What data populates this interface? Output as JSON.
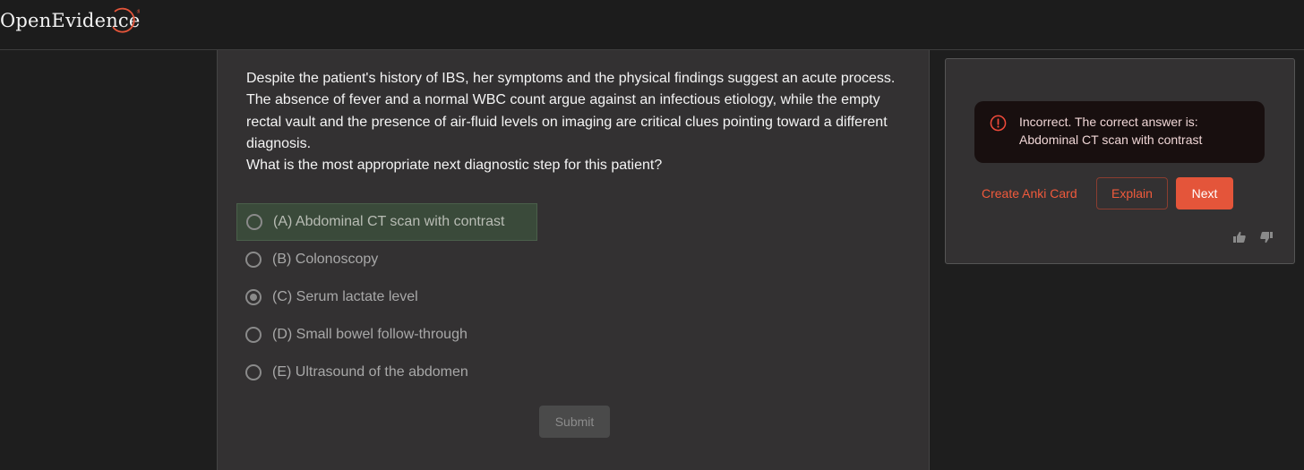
{
  "header": {
    "logo_text": "OpenEvidence",
    "trademark": "®"
  },
  "question": {
    "paragraphs": [
      "Despite the patient's history of IBS, her symptoms and the physical findings suggest an acute process. The absence of fever and a normal WBC count argue against an infectious etiology, while the empty rectal vault and the presence of air-fluid levels on imaging are critical clues pointing toward a different diagnosis.",
      "What is the most appropriate next diagnostic step for this patient?"
    ],
    "options": [
      {
        "label": "(A) Abdominal CT scan with contrast",
        "state": "correct"
      },
      {
        "label": "(B) Colonoscopy",
        "state": "none"
      },
      {
        "label": "(C) Serum lactate level",
        "state": "selected"
      },
      {
        "label": "(D) Small bowel follow-through",
        "state": "none"
      },
      {
        "label": "(E) Ultrasound of the abdomen",
        "state": "none"
      }
    ],
    "submit_label": "Submit"
  },
  "feedback": {
    "alert_text": "Incorrect. The correct answer is: Abdominal CT scan with contrast",
    "anki_label": "Create Anki Card",
    "explain_label": "Explain",
    "next_label": "Next",
    "icons": [
      "error-circle-icon",
      "thumbs-up-icon",
      "thumbs-down-icon"
    ]
  },
  "colors": {
    "accent": "#e4553a",
    "background": "#1e1e1e",
    "panel": "#333132",
    "correct_highlight": "#3a4a3a"
  }
}
